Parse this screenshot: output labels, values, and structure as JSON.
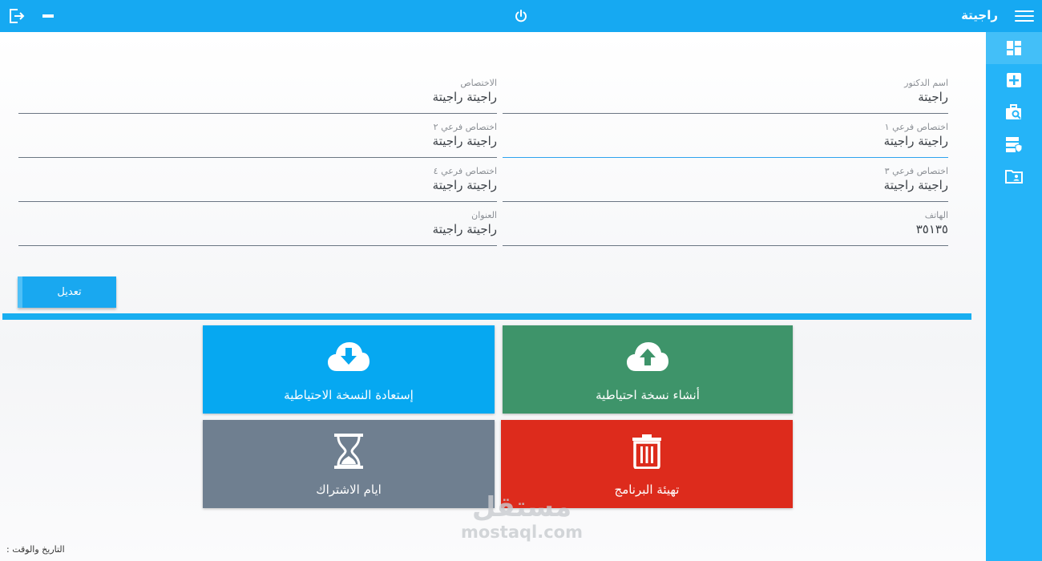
{
  "header": {
    "title": "راجيتة",
    "icons": {
      "menu": "menu-icon",
      "power": "power-icon",
      "exit": "exit-icon",
      "minimize": "minimize-icon"
    }
  },
  "sidebar": {
    "items": [
      {
        "icon": "dashboard-icon",
        "active": true
      },
      {
        "icon": "add-icon",
        "active": false
      },
      {
        "icon": "briefcase-search-icon",
        "active": false
      },
      {
        "icon": "server-shield-icon",
        "active": false
      },
      {
        "icon": "folder-user-icon",
        "active": false
      }
    ]
  },
  "form": {
    "doctor_name": {
      "label": "اسم الدكتور",
      "value": "راجيتة"
    },
    "specialty": {
      "label": "الاختصاص",
      "value": "راجيتة راجيتة"
    },
    "sub1": {
      "label": "اختصاص فرعي ١",
      "value": "راجيتة راجيتة"
    },
    "sub2": {
      "label": "اختصاص فرعي ٢",
      "value": "راجيتة راجيتة"
    },
    "sub3": {
      "label": "اختصاص فرعي ٣",
      "value": "راجيتة راجيتة"
    },
    "sub4": {
      "label": "اختصاص فرعي ٤",
      "value": "راجيتة راجيتة"
    },
    "phone": {
      "label": "الهاتف",
      "value": "٣٥١٣٥"
    },
    "address": {
      "label": "العنوان",
      "value": "راجيتة راجيتة"
    },
    "edit_label": "تعديل"
  },
  "tiles": {
    "backup": {
      "label": "أنشاء نسخة احتياطية",
      "icon": "cloud-upload-icon",
      "color": "#3e946a"
    },
    "restore": {
      "label": "إستعادة النسخة الاحتياطية",
      "icon": "cloud-download-icon",
      "color": "#06a8f1"
    },
    "reset": {
      "label": "تهيئة البرنامج",
      "icon": "trash-icon",
      "color": "#dd2b1c"
    },
    "subscription": {
      "label": "ايام الاشتراك",
      "icon": "hourglass-icon",
      "color": "#6f7f90"
    }
  },
  "footer": {
    "datetime_label": "التاريخ والوقت :"
  },
  "watermark": {
    "logo": "مستقل",
    "site": "mostaql.com"
  },
  "colors": {
    "accent": "#16a9f2",
    "sidebar": "#25b4f8"
  }
}
